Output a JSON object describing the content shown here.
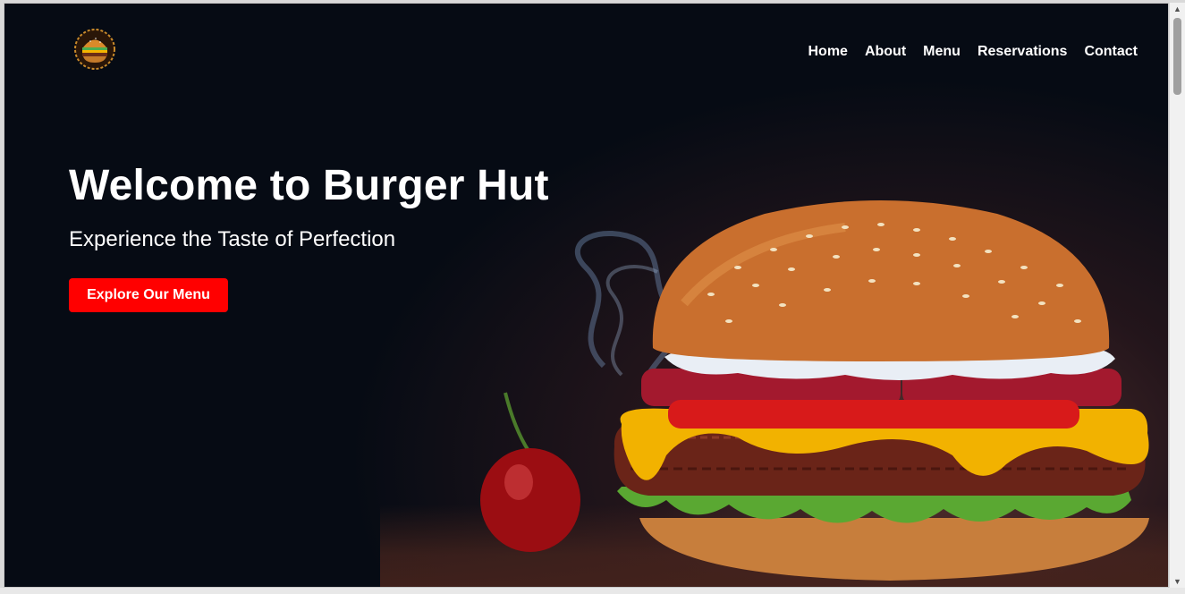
{
  "header": {
    "logo_icon": "burger-logo-icon",
    "nav": [
      {
        "label": "Home"
      },
      {
        "label": "About"
      },
      {
        "label": "Menu"
      },
      {
        "label": "Reservations"
      },
      {
        "label": "Contact"
      }
    ]
  },
  "hero": {
    "title": "Welcome to Burger Hut",
    "subtitle": "Experience the Taste of Perfection",
    "cta_label": "Explore Our Menu",
    "image_icon": "burger-photo"
  },
  "colors": {
    "background": "#060b14",
    "accent": "#ff0000",
    "text": "#ffffff"
  }
}
